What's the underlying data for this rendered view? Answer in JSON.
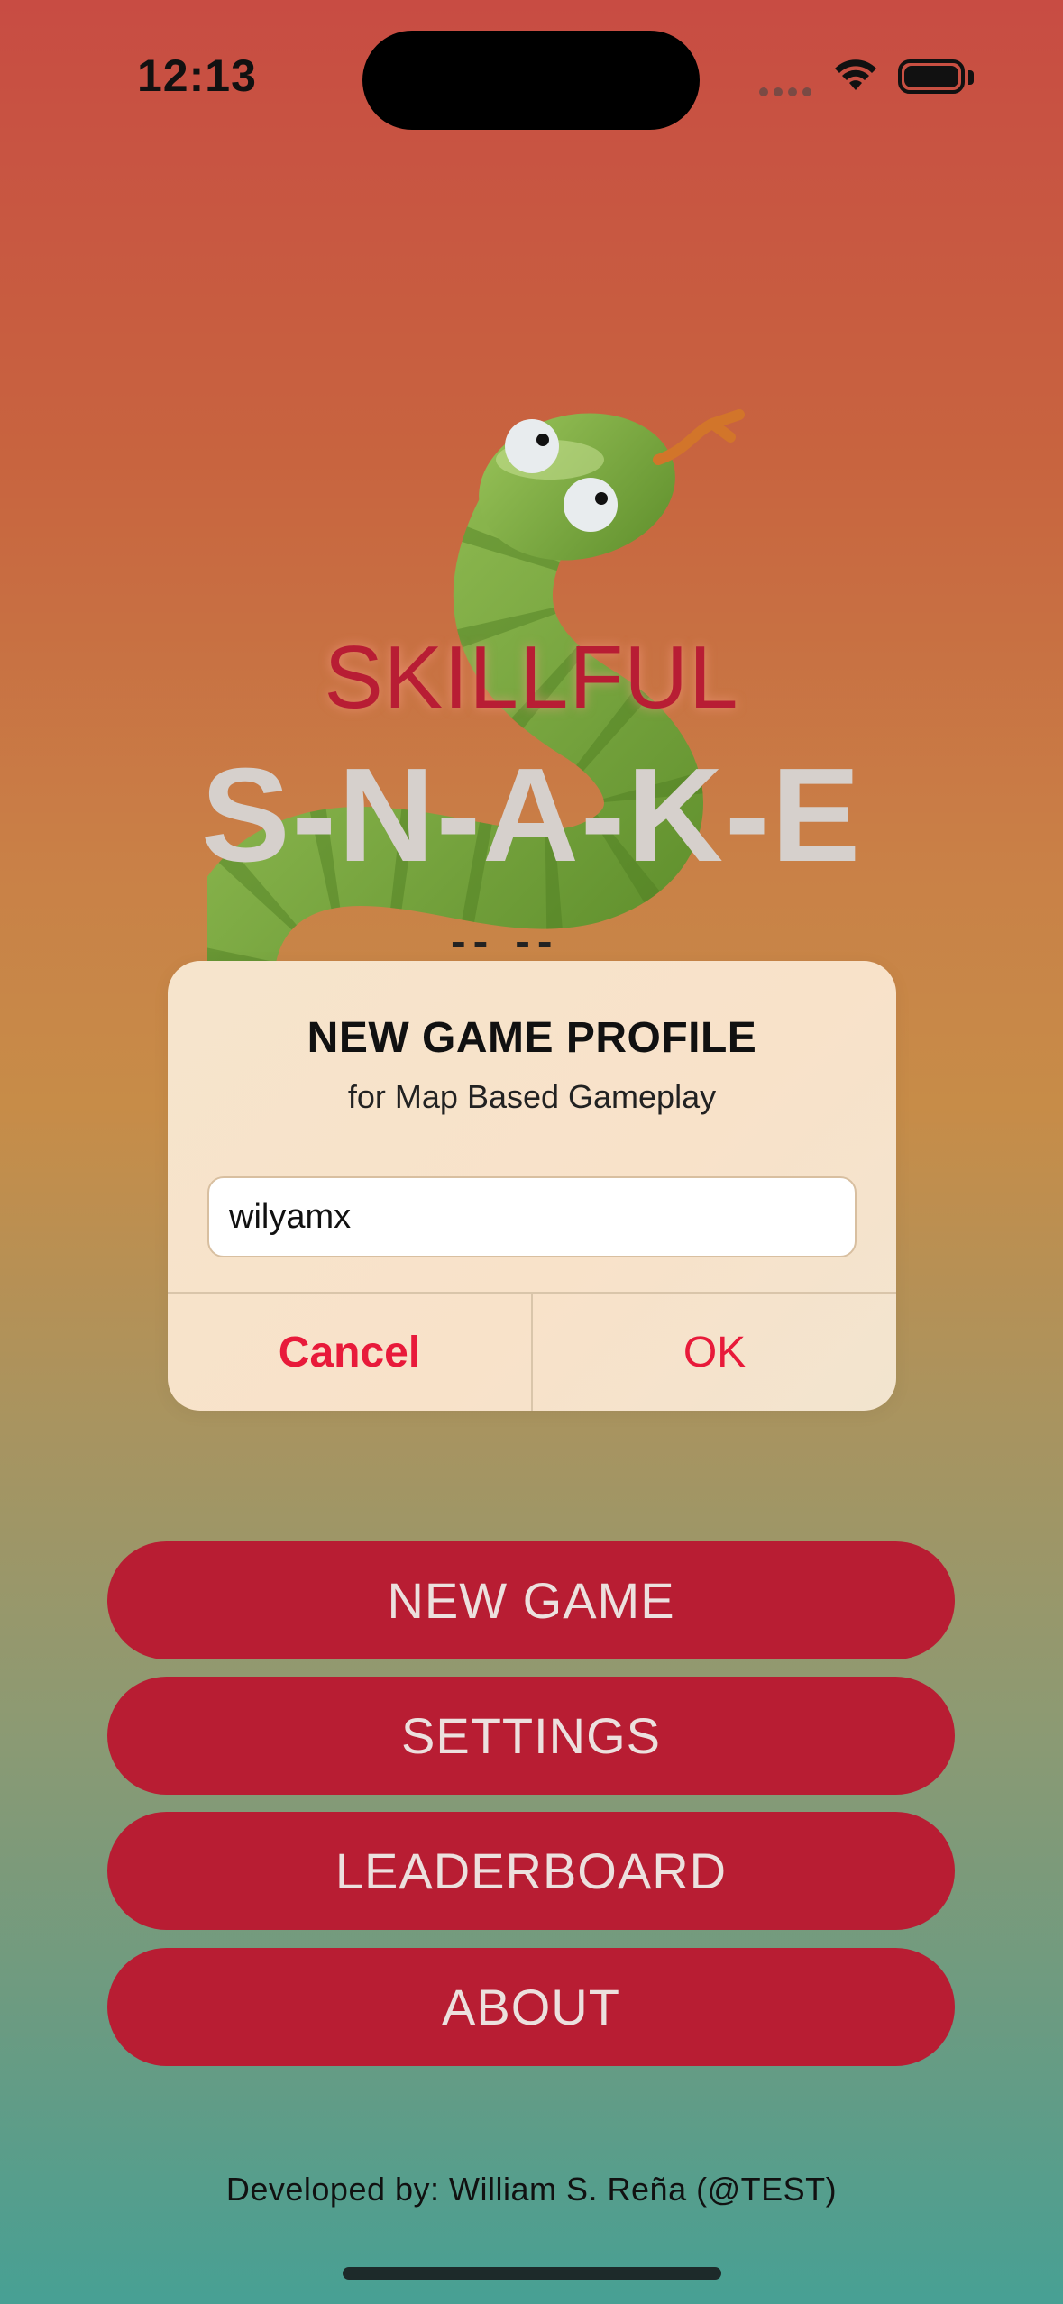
{
  "status_bar": {
    "time": "12:13",
    "icons": [
      "cellular-icon",
      "wifi-icon",
      "battery-icon"
    ]
  },
  "hero": {
    "title_top": "SKILLFUL",
    "title_main": "S-N-A-K-E",
    "dashes": "-- --",
    "image": "snake-illustration"
  },
  "dialog": {
    "title": "NEW GAME PROFILE",
    "subtitle": "for Map Based Gameplay",
    "input_value": "wilyamx",
    "cancel_label": "Cancel",
    "ok_label": "OK"
  },
  "menu": {
    "new_game": "NEW GAME",
    "settings": "SETTINGS",
    "leaderboard": "LEADERBOARD",
    "about": "ABOUT"
  },
  "footer": {
    "credit": "Developed by: William S. Reña (@TEST)"
  },
  "colors": {
    "accent": "#b81d33",
    "dialog_action": "#e81a3a",
    "title_red": "#b81d34"
  }
}
